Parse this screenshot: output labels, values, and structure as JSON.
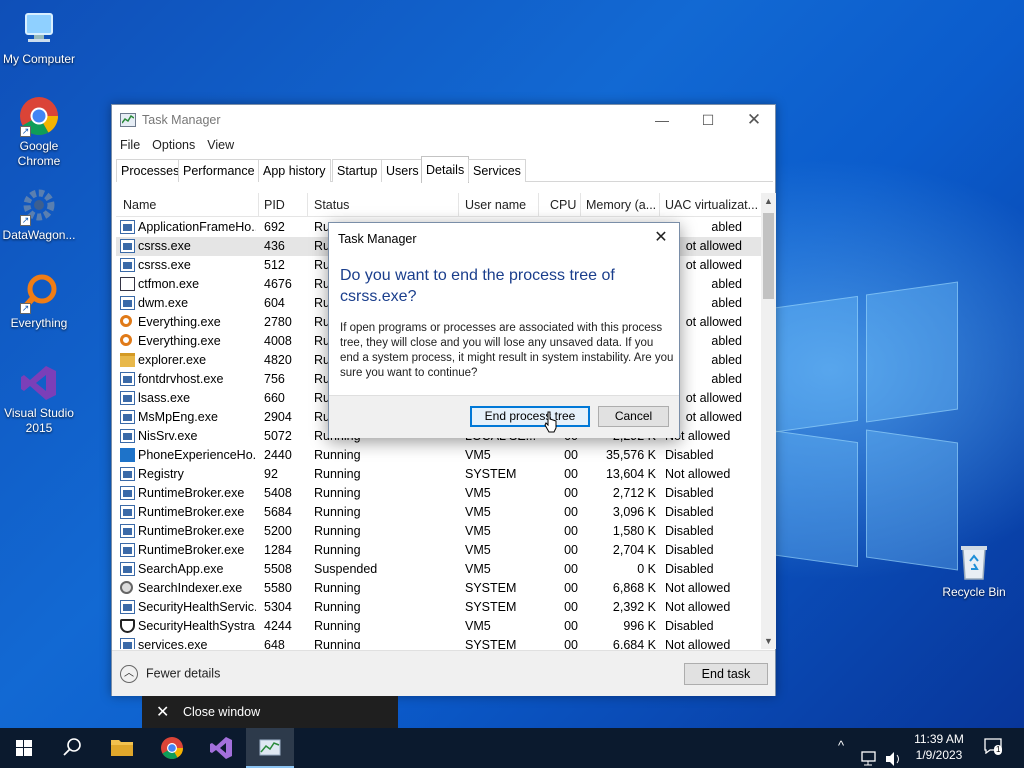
{
  "desktop": {
    "icons": [
      {
        "label": "My Computer"
      },
      {
        "label": "Google Chrome"
      },
      {
        "label": "DataWagon..."
      },
      {
        "label": "Everything"
      },
      {
        "label": "Visual Studio 2015"
      },
      {
        "label": "Recycle Bin"
      }
    ]
  },
  "task_manager": {
    "title": "Task Manager",
    "menu": [
      "File",
      "Options",
      "View"
    ],
    "tabs": [
      "Processes",
      "Performance",
      "App history",
      "Startup",
      "Users",
      "Details",
      "Services"
    ],
    "active_tab": "Details",
    "columns": [
      "Name",
      "PID",
      "Status",
      "User name",
      "CPU",
      "Memory (a...",
      "UAC virtualizat..."
    ],
    "rows": [
      {
        "name": "ApplicationFrameHo...",
        "pid": "692",
        "status": "Ru",
        "user": "",
        "cpu": "",
        "mem": "",
        "uac": "abled",
        "icon": "win"
      },
      {
        "name": "csrss.exe",
        "pid": "436",
        "status": "Ru",
        "user": "",
        "cpu": "",
        "mem": "",
        "uac": "ot allowed",
        "icon": "win"
      },
      {
        "name": "csrss.exe",
        "pid": "512",
        "status": "Ru",
        "user": "",
        "cpu": "",
        "mem": "",
        "uac": "ot allowed",
        "icon": "win"
      },
      {
        "name": "ctfmon.exe",
        "pid": "4676",
        "status": "Ru",
        "user": "",
        "cpu": "",
        "mem": "",
        "uac": "abled",
        "icon": "pen"
      },
      {
        "name": "dwm.exe",
        "pid": "604",
        "status": "Ru",
        "user": "",
        "cpu": "",
        "mem": "",
        "uac": "abled",
        "icon": "win"
      },
      {
        "name": "Everything.exe",
        "pid": "2780",
        "status": "Ru",
        "user": "",
        "cpu": "",
        "mem": "",
        "uac": "ot allowed",
        "icon": "ev"
      },
      {
        "name": "Everything.exe",
        "pid": "4008",
        "status": "Ru",
        "user": "",
        "cpu": "",
        "mem": "",
        "uac": "abled",
        "icon": "ev"
      },
      {
        "name": "explorer.exe",
        "pid": "4820",
        "status": "Ru",
        "user": "",
        "cpu": "",
        "mem": "",
        "uac": "abled",
        "icon": "folder"
      },
      {
        "name": "fontdrvhost.exe",
        "pid": "756",
        "status": "Ru",
        "user": "",
        "cpu": "",
        "mem": "",
        "uac": "abled",
        "icon": "win"
      },
      {
        "name": "lsass.exe",
        "pid": "660",
        "status": "Ru",
        "user": "",
        "cpu": "",
        "mem": "",
        "uac": "ot allowed",
        "icon": "win"
      },
      {
        "name": "MsMpEng.exe",
        "pid": "2904",
        "status": "Ru",
        "user": "",
        "cpu": "",
        "mem": "",
        "uac": "ot allowed",
        "icon": "win"
      },
      {
        "name": "NisSrv.exe",
        "pid": "5072",
        "status": "Running",
        "user": "LOCAL SE...",
        "cpu": "00",
        "mem": "2,292 K",
        "uac": "Not allowed",
        "icon": "win"
      },
      {
        "name": "PhoneExperienceHo...",
        "pid": "2440",
        "status": "Running",
        "user": "VM5",
        "cpu": "00",
        "mem": "35,576 K",
        "uac": "Disabled",
        "icon": "phone"
      },
      {
        "name": "Registry",
        "pid": "92",
        "status": "Running",
        "user": "SYSTEM",
        "cpu": "00",
        "mem": "13,604 K",
        "uac": "Not allowed",
        "icon": "win"
      },
      {
        "name": "RuntimeBroker.exe",
        "pid": "5408",
        "status": "Running",
        "user": "VM5",
        "cpu": "00",
        "mem": "2,712 K",
        "uac": "Disabled",
        "icon": "win"
      },
      {
        "name": "RuntimeBroker.exe",
        "pid": "5684",
        "status": "Running",
        "user": "VM5",
        "cpu": "00",
        "mem": "3,096 K",
        "uac": "Disabled",
        "icon": "win"
      },
      {
        "name": "RuntimeBroker.exe",
        "pid": "5200",
        "status": "Running",
        "user": "VM5",
        "cpu": "00",
        "mem": "1,580 K",
        "uac": "Disabled",
        "icon": "win"
      },
      {
        "name": "RuntimeBroker.exe",
        "pid": "1284",
        "status": "Running",
        "user": "VM5",
        "cpu": "00",
        "mem": "2,704 K",
        "uac": "Disabled",
        "icon": "win"
      },
      {
        "name": "SearchApp.exe",
        "pid": "5508",
        "status": "Suspended",
        "user": "VM5",
        "cpu": "00",
        "mem": "0 K",
        "uac": "Disabled",
        "icon": "win"
      },
      {
        "name": "SearchIndexer.exe",
        "pid": "5580",
        "status": "Running",
        "user": "SYSTEM",
        "cpu": "00",
        "mem": "6,868 K",
        "uac": "Not allowed",
        "icon": "search"
      },
      {
        "name": "SecurityHealthServic...",
        "pid": "5304",
        "status": "Running",
        "user": "SYSTEM",
        "cpu": "00",
        "mem": "2,392 K",
        "uac": "Not allowed",
        "icon": "win"
      },
      {
        "name": "SecurityHealthSystra...",
        "pid": "4244",
        "status": "Running",
        "user": "VM5",
        "cpu": "00",
        "mem": "996 K",
        "uac": "Disabled",
        "icon": "shield"
      },
      {
        "name": "services.exe",
        "pid": "648",
        "status": "Running",
        "user": "SYSTEM",
        "cpu": "00",
        "mem": "6,684 K",
        "uac": "Not allowed",
        "icon": "win"
      }
    ],
    "selected_row": 1,
    "fewer_details": "Fewer details",
    "end_task": "End task"
  },
  "dialog": {
    "title": "Task Manager",
    "heading": "Do you want to end the process tree of csrss.exe?",
    "body": "If open programs or processes are associated with this process tree, they will close and you will lose any unsaved data. If you end a system process, it might result in system instability. Are you sure you want to continue?",
    "confirm_label": "End process tree",
    "cancel_label": "Cancel"
  },
  "close_window_tooltip": "Close window",
  "taskbar": {
    "time": "11:39 AM",
    "date": "1/9/2023",
    "notification_count": "1"
  },
  "colors": {
    "accent": "#0078d7",
    "dialog_heading": "#1a3e8c",
    "selection": "#e5e5e5",
    "taskbar": "#0b1a2e"
  }
}
